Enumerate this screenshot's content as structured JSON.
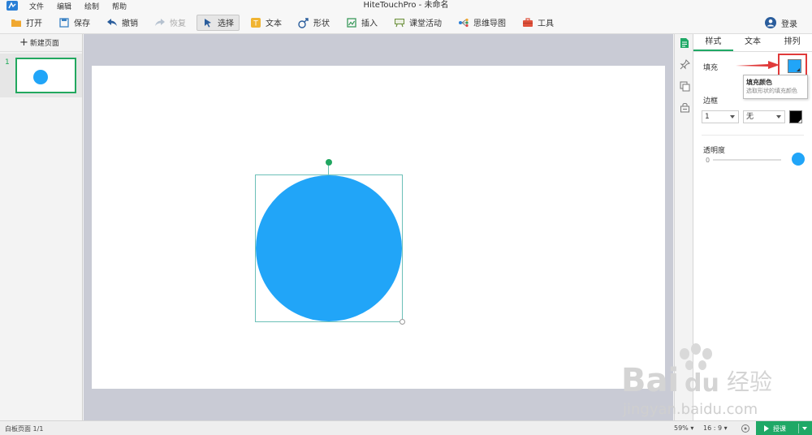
{
  "window": {
    "title": "HiteTouchPro - 未命名"
  },
  "menu": {
    "items": [
      "文件",
      "编辑",
      "绘制",
      "帮助"
    ]
  },
  "toolbar": {
    "open": "打开",
    "save": "保存",
    "undo": "撤销",
    "redo": "恢复",
    "select": "选择",
    "text": "文本",
    "shape": "形状",
    "insert": "插入",
    "classroom": "课堂活动",
    "mindmap": "思维导图",
    "tools": "工具",
    "login": "登录"
  },
  "pages": {
    "new_page": "新建页面",
    "items": [
      {
        "number": "1"
      }
    ]
  },
  "canvas": {
    "shape": {
      "type": "circle",
      "fill": "#21a5f8"
    }
  },
  "properties": {
    "tabs": [
      "样式",
      "文本",
      "排列"
    ],
    "fill_label": "填充",
    "fill_color": "#21a5f8",
    "tooltip": {
      "title": "填充颜色",
      "description": "选取形状的填充颜色"
    },
    "border_label": "边框",
    "border_width": "1",
    "border_style": "无",
    "border_color": "#000000",
    "opacity_label": "透明度",
    "opacity_value": "0"
  },
  "watermark": {
    "brand": "Bai du 经验",
    "url": "jingyan.baidu.com"
  },
  "status": {
    "page": "白板页面 1/1",
    "zoom": "59%",
    "ratio": "16 : 9",
    "present": "授课"
  },
  "colors": {
    "accent": "#1fa866",
    "highlight": "#e03a3a"
  }
}
